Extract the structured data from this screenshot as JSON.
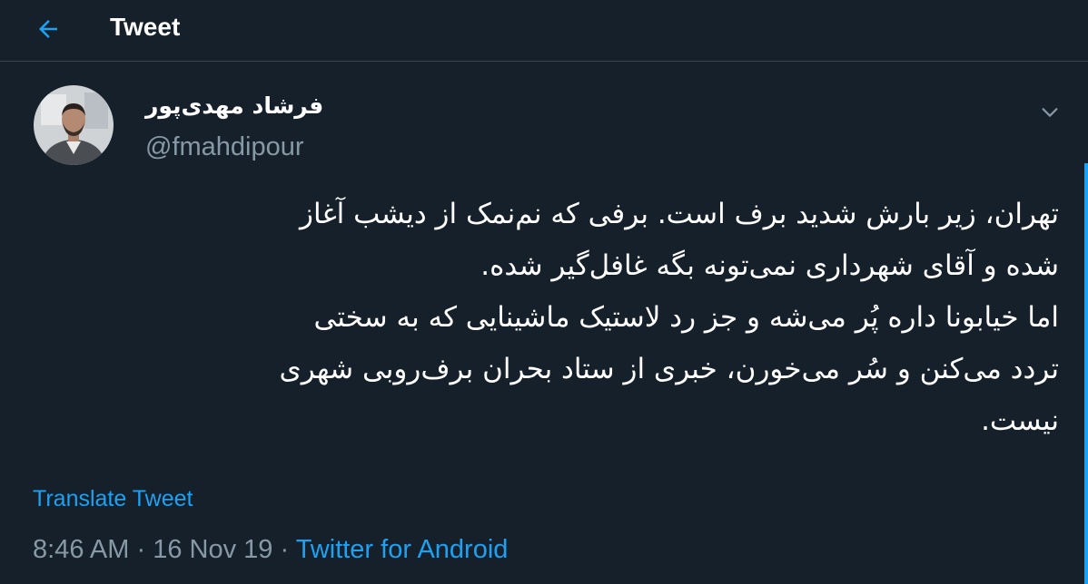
{
  "header": {
    "title": "Tweet",
    "back_icon": "arrow-left-icon"
  },
  "tweet": {
    "author": {
      "display_name": "فرشاد مهدی‌پور",
      "handle": "@fmahdipour"
    },
    "menu_icon": "chevron-down-icon",
    "text_lines": [
      "تهران، زیر بارش شدید برف است. برفی که نم‌نمک از دیشب آغاز",
      "شده و آقای شهرداری نمی‌تونه بگه غافل‌گیر شده.",
      "اما خیابونا داره پُر می‌شه و جز رد لاستیک ماشینایی که به سختی",
      "تردد می‌کنن و سُر می‌خورن، خبری از ستاد بحران برف‌روبی شهری",
      "نیست."
    ],
    "translate_label": "Translate Tweet",
    "time": "8:46 AM",
    "separator": "·",
    "date": "16 Nov 19",
    "source": "Twitter for Android"
  },
  "colors": {
    "background": "#15202b",
    "accent": "#1da1f2",
    "secondary_text": "#8899a6",
    "divider": "#38444d"
  }
}
